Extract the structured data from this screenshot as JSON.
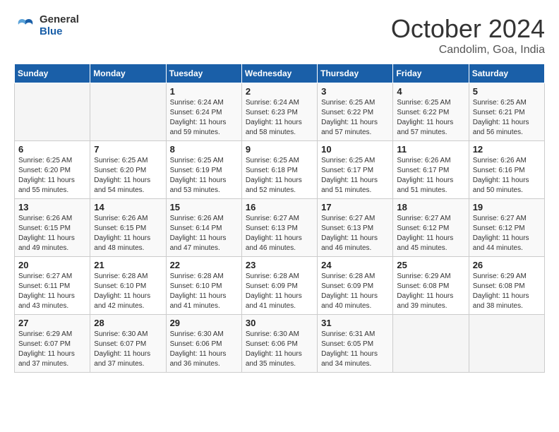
{
  "header": {
    "logo_line1": "General",
    "logo_line2": "Blue",
    "month": "October 2024",
    "location": "Candolim, Goa, India"
  },
  "weekdays": [
    "Sunday",
    "Monday",
    "Tuesday",
    "Wednesday",
    "Thursday",
    "Friday",
    "Saturday"
  ],
  "weeks": [
    [
      {
        "day": "",
        "sunrise": "",
        "sunset": "",
        "daylight": ""
      },
      {
        "day": "",
        "sunrise": "",
        "sunset": "",
        "daylight": ""
      },
      {
        "day": "1",
        "sunrise": "Sunrise: 6:24 AM",
        "sunset": "Sunset: 6:24 PM",
        "daylight": "Daylight: 11 hours and 59 minutes."
      },
      {
        "day": "2",
        "sunrise": "Sunrise: 6:24 AM",
        "sunset": "Sunset: 6:23 PM",
        "daylight": "Daylight: 11 hours and 58 minutes."
      },
      {
        "day": "3",
        "sunrise": "Sunrise: 6:25 AM",
        "sunset": "Sunset: 6:22 PM",
        "daylight": "Daylight: 11 hours and 57 minutes."
      },
      {
        "day": "4",
        "sunrise": "Sunrise: 6:25 AM",
        "sunset": "Sunset: 6:22 PM",
        "daylight": "Daylight: 11 hours and 57 minutes."
      },
      {
        "day": "5",
        "sunrise": "Sunrise: 6:25 AM",
        "sunset": "Sunset: 6:21 PM",
        "daylight": "Daylight: 11 hours and 56 minutes."
      }
    ],
    [
      {
        "day": "6",
        "sunrise": "Sunrise: 6:25 AM",
        "sunset": "Sunset: 6:20 PM",
        "daylight": "Daylight: 11 hours and 55 minutes."
      },
      {
        "day": "7",
        "sunrise": "Sunrise: 6:25 AM",
        "sunset": "Sunset: 6:20 PM",
        "daylight": "Daylight: 11 hours and 54 minutes."
      },
      {
        "day": "8",
        "sunrise": "Sunrise: 6:25 AM",
        "sunset": "Sunset: 6:19 PM",
        "daylight": "Daylight: 11 hours and 53 minutes."
      },
      {
        "day": "9",
        "sunrise": "Sunrise: 6:25 AM",
        "sunset": "Sunset: 6:18 PM",
        "daylight": "Daylight: 11 hours and 52 minutes."
      },
      {
        "day": "10",
        "sunrise": "Sunrise: 6:25 AM",
        "sunset": "Sunset: 6:17 PM",
        "daylight": "Daylight: 11 hours and 51 minutes."
      },
      {
        "day": "11",
        "sunrise": "Sunrise: 6:26 AM",
        "sunset": "Sunset: 6:17 PM",
        "daylight": "Daylight: 11 hours and 51 minutes."
      },
      {
        "day": "12",
        "sunrise": "Sunrise: 6:26 AM",
        "sunset": "Sunset: 6:16 PM",
        "daylight": "Daylight: 11 hours and 50 minutes."
      }
    ],
    [
      {
        "day": "13",
        "sunrise": "Sunrise: 6:26 AM",
        "sunset": "Sunset: 6:15 PM",
        "daylight": "Daylight: 11 hours and 49 minutes."
      },
      {
        "day": "14",
        "sunrise": "Sunrise: 6:26 AM",
        "sunset": "Sunset: 6:15 PM",
        "daylight": "Daylight: 11 hours and 48 minutes."
      },
      {
        "day": "15",
        "sunrise": "Sunrise: 6:26 AM",
        "sunset": "Sunset: 6:14 PM",
        "daylight": "Daylight: 11 hours and 47 minutes."
      },
      {
        "day": "16",
        "sunrise": "Sunrise: 6:27 AM",
        "sunset": "Sunset: 6:13 PM",
        "daylight": "Daylight: 11 hours and 46 minutes."
      },
      {
        "day": "17",
        "sunrise": "Sunrise: 6:27 AM",
        "sunset": "Sunset: 6:13 PM",
        "daylight": "Daylight: 11 hours and 46 minutes."
      },
      {
        "day": "18",
        "sunrise": "Sunrise: 6:27 AM",
        "sunset": "Sunset: 6:12 PM",
        "daylight": "Daylight: 11 hours and 45 minutes."
      },
      {
        "day": "19",
        "sunrise": "Sunrise: 6:27 AM",
        "sunset": "Sunset: 6:12 PM",
        "daylight": "Daylight: 11 hours and 44 minutes."
      }
    ],
    [
      {
        "day": "20",
        "sunrise": "Sunrise: 6:27 AM",
        "sunset": "Sunset: 6:11 PM",
        "daylight": "Daylight: 11 hours and 43 minutes."
      },
      {
        "day": "21",
        "sunrise": "Sunrise: 6:28 AM",
        "sunset": "Sunset: 6:10 PM",
        "daylight": "Daylight: 11 hours and 42 minutes."
      },
      {
        "day": "22",
        "sunrise": "Sunrise: 6:28 AM",
        "sunset": "Sunset: 6:10 PM",
        "daylight": "Daylight: 11 hours and 41 minutes."
      },
      {
        "day": "23",
        "sunrise": "Sunrise: 6:28 AM",
        "sunset": "Sunset: 6:09 PM",
        "daylight": "Daylight: 11 hours and 41 minutes."
      },
      {
        "day": "24",
        "sunrise": "Sunrise: 6:28 AM",
        "sunset": "Sunset: 6:09 PM",
        "daylight": "Daylight: 11 hours and 40 minutes."
      },
      {
        "day": "25",
        "sunrise": "Sunrise: 6:29 AM",
        "sunset": "Sunset: 6:08 PM",
        "daylight": "Daylight: 11 hours and 39 minutes."
      },
      {
        "day": "26",
        "sunrise": "Sunrise: 6:29 AM",
        "sunset": "Sunset: 6:08 PM",
        "daylight": "Daylight: 11 hours and 38 minutes."
      }
    ],
    [
      {
        "day": "27",
        "sunrise": "Sunrise: 6:29 AM",
        "sunset": "Sunset: 6:07 PM",
        "daylight": "Daylight: 11 hours and 37 minutes."
      },
      {
        "day": "28",
        "sunrise": "Sunrise: 6:30 AM",
        "sunset": "Sunset: 6:07 PM",
        "daylight": "Daylight: 11 hours and 37 minutes."
      },
      {
        "day": "29",
        "sunrise": "Sunrise: 6:30 AM",
        "sunset": "Sunset: 6:06 PM",
        "daylight": "Daylight: 11 hours and 36 minutes."
      },
      {
        "day": "30",
        "sunrise": "Sunrise: 6:30 AM",
        "sunset": "Sunset: 6:06 PM",
        "daylight": "Daylight: 11 hours and 35 minutes."
      },
      {
        "day": "31",
        "sunrise": "Sunrise: 6:31 AM",
        "sunset": "Sunset: 6:05 PM",
        "daylight": "Daylight: 11 hours and 34 minutes."
      },
      {
        "day": "",
        "sunrise": "",
        "sunset": "",
        "daylight": ""
      },
      {
        "day": "",
        "sunrise": "",
        "sunset": "",
        "daylight": ""
      }
    ]
  ]
}
